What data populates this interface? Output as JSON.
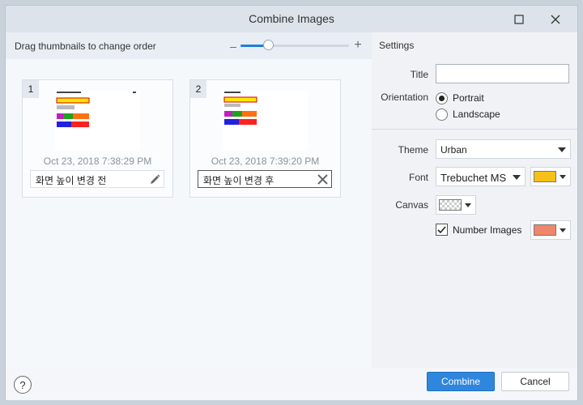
{
  "window": {
    "title": "Combine Images"
  },
  "left": {
    "instruction": "Drag thumbnails to change order",
    "zoom": {
      "minus": "–",
      "plus": "+",
      "level": 0.25
    },
    "thumbnails": [
      {
        "number": "1",
        "date": "Oct 23, 2018 7:38:29 PM",
        "name": "화면 높이 변경 전",
        "action_icon": "pencil-icon"
      },
      {
        "number": "2",
        "date": "Oct 23, 2018 7:39:20 PM",
        "name": "화면 높이 변경 후",
        "action_icon": "clear-icon"
      }
    ]
  },
  "settings": {
    "heading": "Settings",
    "title_label": "Title",
    "title_value": "",
    "orientation_label": "Orientation",
    "orientation_options": [
      "Portrait",
      "Landscape"
    ],
    "orientation_selected": "Portrait",
    "theme_label": "Theme",
    "theme_value": "Urban",
    "font_label": "Font",
    "font_value": "Trebuchet MS",
    "font_color": "#f5c018",
    "canvas_label": "Canvas",
    "canvas_value": "transparent",
    "number_images_label": "Number Images",
    "number_images_checked": true,
    "number_color": "#f0876a"
  },
  "footer": {
    "help": "?",
    "combine": "Combine",
    "cancel": "Cancel"
  }
}
